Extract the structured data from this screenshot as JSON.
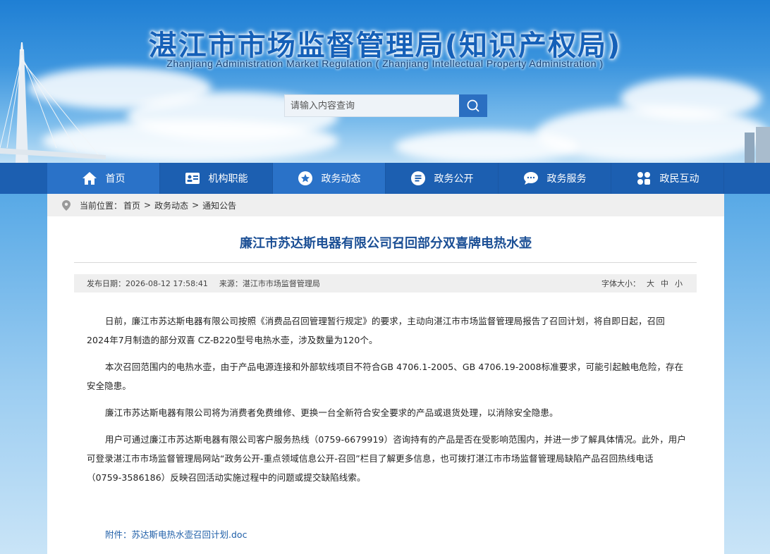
{
  "header": {
    "title": "湛江市市场监督管理局(知识产权局)",
    "subtitle": "Zhanjiang Administration Market Regulation ( Zhanjiang Intellectual Property Administration )",
    "search": {
      "placeholder": "请输入内容查询",
      "icon": "search-icon"
    }
  },
  "nav": {
    "items": [
      {
        "label": "首页",
        "icon": "home-icon"
      },
      {
        "label": "机构职能",
        "icon": "id-card-icon"
      },
      {
        "label": "政务动态",
        "icon": "star-icon"
      },
      {
        "label": "政务公开",
        "icon": "document-icon"
      },
      {
        "label": "政务服务",
        "icon": "chat-bubble-icon"
      },
      {
        "label": "政民互动",
        "icon": "grid-icon"
      }
    ],
    "active_color": "#2a72c8",
    "bar_color": "#1c5fb1"
  },
  "breadcrumb": {
    "prefix": "当前位置：",
    "items": [
      "首页",
      "政务动态",
      "通知公告"
    ],
    "separator": ">"
  },
  "article": {
    "title": "廉江市苏达斯电器有限公司召回部分双喜牌电热水壶",
    "meta": {
      "date_label": "发布日期：",
      "date": "2026-08-12 17:58:41",
      "source_label": "来源：",
      "source": "湛江市市场监督管理局",
      "font_size_label": "字体大小：",
      "font_sizes": [
        "大",
        "中",
        "小"
      ]
    },
    "paragraphs": [
      "日前，廉江市苏达斯电器有限公司按照《消费品召回管理暂行规定》的要求，主动向湛江市市场监督管理局报告了召回计划，将自即日起，召回2024年7月制造的部分双喜 CZ-B220型号电热水壶，涉及数量为120个。",
      "本次召回范围内的电热水壶，由于产品电源连接和外部软线项目不符合GB 4706.1-2005、GB 4706.19-2008标准要求，可能引起触电危险，存在安全隐患。",
      "廉江市苏达斯电器有限公司将为消费者免费维修、更换一台全新符合安全要求的产品或退货处理，以消除安全隐患。",
      "用户可通过廉江市苏达斯电器有限公司客户服务热线（0759-6679919）咨询持有的产品是否在受影响范围内，并进一步了解具体情况。此外，用户可登录湛江市市场监督管理局网站“政务公开-重点领域信息公开-召回”栏目了解更多信息，也可拨打湛江市市场监督管理局缺陷产品召回热线电话（0759-3586186）反映召回活动实施过程中的问题或提交缺陷线索。"
    ],
    "attachment": {
      "label": "附件：",
      "file": "苏达斯电热水壶召回计划.doc"
    }
  }
}
